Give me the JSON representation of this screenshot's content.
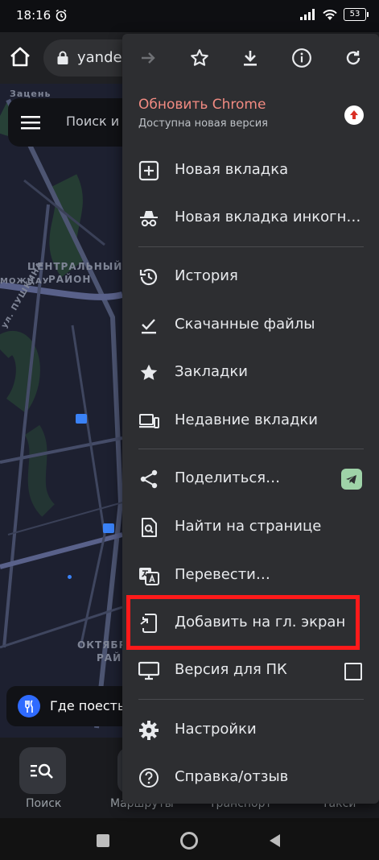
{
  "status_bar": {
    "time": "18:16",
    "battery": "53"
  },
  "browser": {
    "url": "yandex"
  },
  "map": {
    "search_placeholder": "Поиск и в",
    "labels": {
      "district1": "ЦЕНТРАЛЬНЫЙ",
      "district1b": "РАЙОН",
      "street": "ул. ПУШКИНА",
      "district2": "ОКТЯБР",
      "district2b": "РАЙ",
      "top_label": "Зацень",
      "left_label": "МОЖЦАУ"
    },
    "food_chip": "Где поесть"
  },
  "bottom_nav": {
    "items": [
      "Поиск",
      "Маршруты",
      "Транспорт",
      "Такси"
    ]
  },
  "menu": {
    "toolbar_icons": [
      "forward-icon",
      "star-icon",
      "download-icon",
      "info-icon",
      "refresh-icon"
    ],
    "update": {
      "title": "Обновить Chrome",
      "subtitle": "Доступна новая версия"
    },
    "items": [
      {
        "label": "Новая вкладка",
        "icon": "new-tab-icon"
      },
      {
        "label": "Новая вкладка инкогн…",
        "icon": "incognito-icon"
      },
      {
        "label": "История",
        "icon": "history-icon"
      },
      {
        "label": "Скачанные файлы",
        "icon": "downloads-icon"
      },
      {
        "label": "Закладки",
        "icon": "bookmarks-icon"
      },
      {
        "label": "Недавние вкладки",
        "icon": "recent-tabs-icon"
      },
      {
        "label": "Поделиться…",
        "icon": "share-icon"
      },
      {
        "label": "Найти на странице",
        "icon": "find-in-page-icon"
      },
      {
        "label": "Перевести…",
        "icon": "translate-icon"
      },
      {
        "label": "Добавить на гл. экран",
        "icon": "add-to-home-icon"
      },
      {
        "label": "Версия для ПК",
        "icon": "desktop-icon"
      },
      {
        "label": "Настройки",
        "icon": "settings-icon"
      },
      {
        "label": "Справка/отзыв",
        "icon": "help-icon"
      }
    ]
  },
  "colors": {
    "accent_update": "#f28b82",
    "highlight": "#ff1a1a",
    "menu_bg": "#2d2e31"
  }
}
